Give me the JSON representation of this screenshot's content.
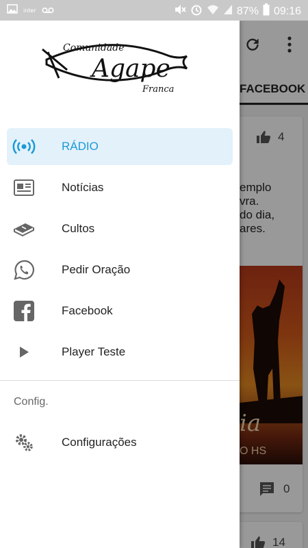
{
  "status_bar": {
    "carrier": "inter",
    "battery": "87%",
    "time": "09:16",
    "icons": [
      "image-icon",
      "voicemail-icon",
      "mute-icon",
      "alarm-icon",
      "wifi-icon",
      "signal-icon",
      "battery-icon"
    ]
  },
  "background": {
    "toolbar_icons": [
      "refresh-icon",
      "more-vert-icon"
    ],
    "active_tab": "FACEBOOK",
    "post": {
      "like_count": "4",
      "text_lines": [
        "emplo",
        "vra.",
        "do dia,",
        "",
        "ares."
      ],
      "image_word": "ia",
      "image_sub": "O HS",
      "comment_count": "0"
    },
    "next_post_like_count": "14"
  },
  "drawer": {
    "logo": {
      "top_text": "Comunidade",
      "main_text": "Agape",
      "bottom_text": "Franca"
    },
    "items": [
      {
        "label": "RÁDIO",
        "icon": "radio-broadcast-icon",
        "active": true
      },
      {
        "label": "Notícias",
        "icon": "newspaper-icon",
        "active": false
      },
      {
        "label": "Cultos",
        "icon": "book-icon",
        "active": false
      },
      {
        "label": "Pedir Oração",
        "icon": "whatsapp-icon",
        "active": false
      },
      {
        "label": "Facebook",
        "icon": "facebook-icon",
        "active": false
      },
      {
        "label": "Player Teste",
        "icon": "play-icon",
        "active": false
      }
    ],
    "section_title": "Config.",
    "settings_item": {
      "label": "Configurações",
      "icon": "gears-icon"
    }
  },
  "colors": {
    "accent": "#1a9ad6",
    "active_bg": "#e3f1fb",
    "icon_gray": "#666666"
  }
}
